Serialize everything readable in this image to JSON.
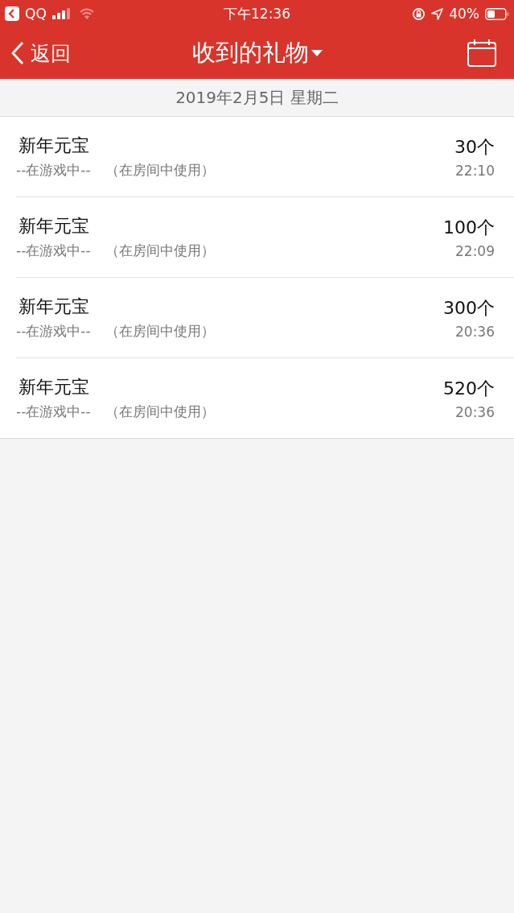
{
  "status_bar": {
    "back_app": "QQ",
    "time": "下午12:36",
    "battery": "40%"
  },
  "nav_bar": {
    "back": "返回",
    "title": "收到的礼物"
  },
  "date_header": "2019年2月5日 星期二",
  "gifts": [
    {
      "name": "新年元宝",
      "source": "--在游戏中--",
      "note": "（在房间中使用）",
      "count": "30个",
      "time": "22:10"
    },
    {
      "name": "新年元宝",
      "source": "--在游戏中--",
      "note": "（在房间中使用）",
      "count": "100个",
      "time": "22:09"
    },
    {
      "name": "新年元宝",
      "source": "--在游戏中--",
      "note": "（在房间中使用）",
      "count": "300个",
      "time": "20:36"
    },
    {
      "name": "新年元宝",
      "source": "--在游戏中--",
      "note": "（在房间中使用）",
      "count": "520个",
      "time": "20:36"
    }
  ]
}
